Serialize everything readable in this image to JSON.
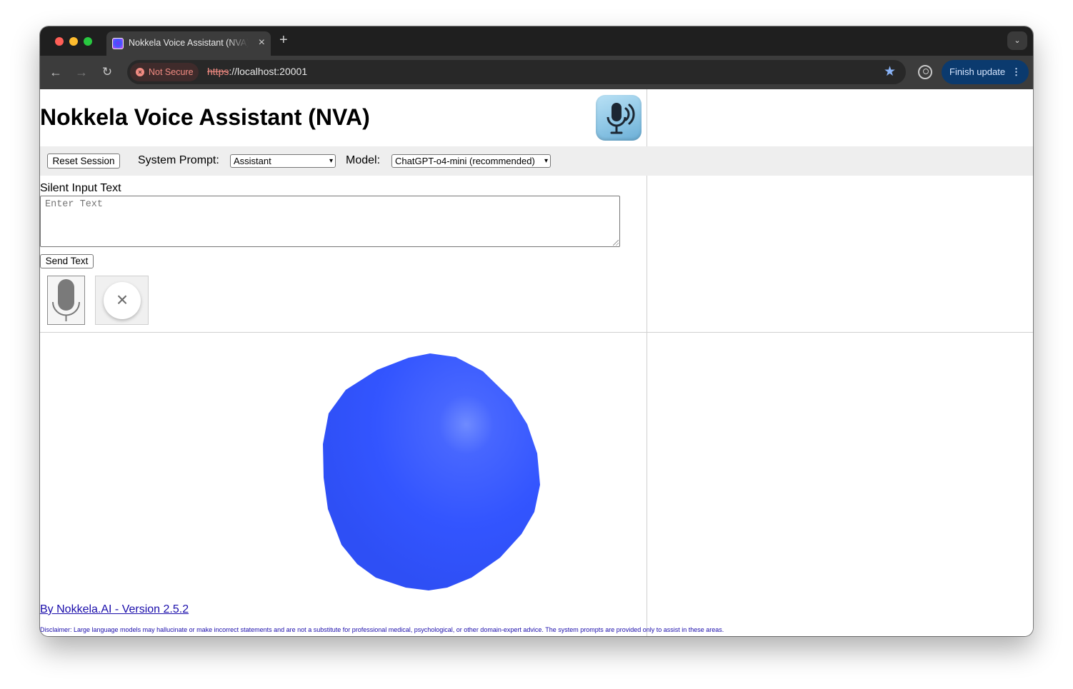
{
  "browser": {
    "tab_title": "Nokkela Voice Assistant (NVA)",
    "security_label": "Not Secure",
    "url_scheme": "https",
    "url_rest": "://localhost:20001",
    "update_button": "Finish update"
  },
  "header": {
    "title": "Nokkela Voice Assistant (NVA)"
  },
  "controls": {
    "reset_label": "Reset Session",
    "system_prompt_label": "System Prompt:",
    "system_prompt_value": "Assistant",
    "model_label": "Model:",
    "model_value": "ChatGPT-o4-mini (recommended)"
  },
  "input": {
    "label": "Silent Input Text",
    "placeholder": "Enter Text",
    "send_label": "Send Text"
  },
  "footer": {
    "link_text": "By Nokkela.AI - Version 2.5.2",
    "disclaimer": "Disclaimer: Large language models may hallucinate or make incorrect statements and are not a substitute for professional medical, psychological, or other domain-expert advice. The system prompts are provided only to assist in these areas."
  },
  "colors": {
    "blob": "#3355ff",
    "link": "#1a0dab",
    "controls_bar": "#eeeeee"
  },
  "icons": {
    "microphone": "microphone-icon",
    "cancel": "close-icon",
    "bookmark": "star-icon"
  }
}
